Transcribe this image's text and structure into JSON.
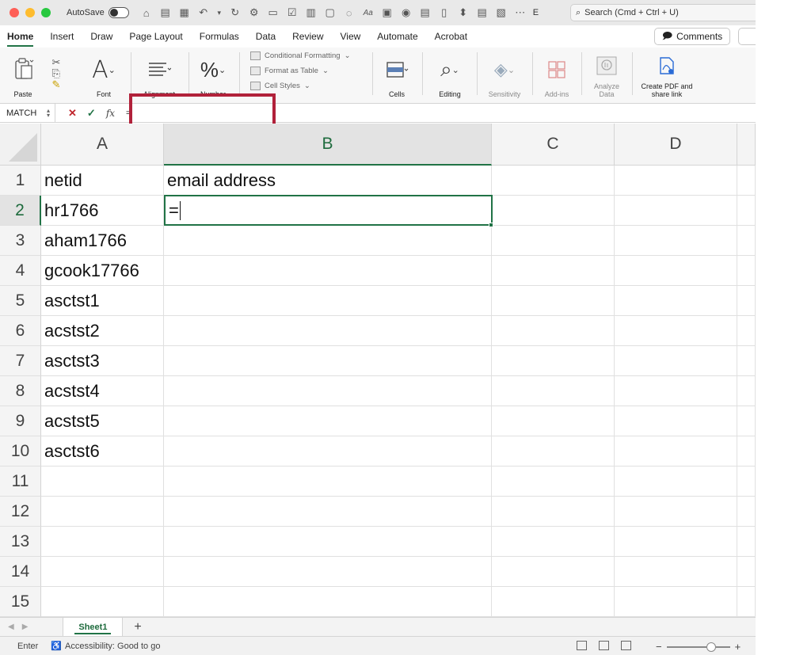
{
  "titlebar": {
    "autosave_label": "AutoSave",
    "title_fragment": "E",
    "search_placeholder": "Search (Cmd + Ctrl + U)"
  },
  "ribbon_tabs": [
    {
      "label": "Home",
      "active": true
    },
    {
      "label": "Insert"
    },
    {
      "label": "Draw"
    },
    {
      "label": "Page Layout"
    },
    {
      "label": "Formulas"
    },
    {
      "label": "Data"
    },
    {
      "label": "Review"
    },
    {
      "label": "View"
    },
    {
      "label": "Automate"
    },
    {
      "label": "Acrobat"
    }
  ],
  "comments_label": "Comments",
  "ribbon": {
    "paste": "Paste",
    "font": "Font",
    "alignment": "Alignment",
    "number": "Number",
    "conditional_formatting": "Conditional Formatting",
    "format_as_table": "Format as Table",
    "cell_styles": "Cell Styles",
    "cells": "Cells",
    "editing": "Editing",
    "sensitivity": "Sensitivity",
    "addins": "Add-ins",
    "analyze_data": "Analyze Data",
    "create_pdf": "Create PDF and share link"
  },
  "formula_bar": {
    "name_box": "MATCH",
    "formula": "="
  },
  "columns": [
    "A",
    "B",
    "C",
    "D"
  ],
  "rows": [
    "1",
    "2",
    "3",
    "4",
    "5",
    "6",
    "7",
    "8",
    "9",
    "10",
    "11",
    "12",
    "13",
    "14",
    "15"
  ],
  "cells": {
    "A1": "netid",
    "B1": "email address",
    "A2": "hr1766",
    "B2": "=",
    "A3": "aham1766",
    "A4": "gcook17766",
    "A5": "asctst1",
    "A6": "acstst2",
    "A7": "asctst3",
    "A8": "acstst4",
    "A9": "acstst5",
    "A10": "asctst6"
  },
  "active_cell": "B2",
  "sheet_tab": "Sheet1",
  "status": {
    "mode": "Enter",
    "accessibility": "Accessibility: Good to go"
  },
  "colors": {
    "accent": "#217346",
    "highlight": "#b1213a"
  }
}
